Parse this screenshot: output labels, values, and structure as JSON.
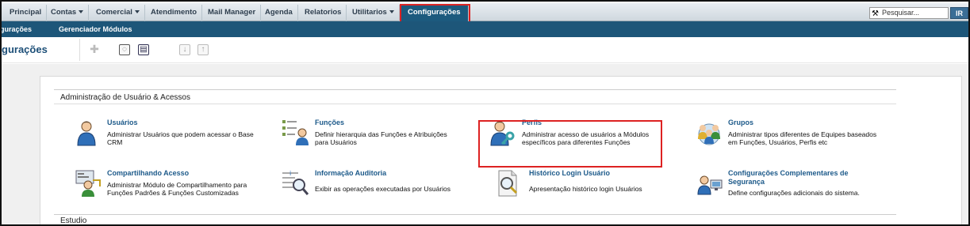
{
  "topnav": {
    "tabs": [
      {
        "label": "Principal",
        "caret": false
      },
      {
        "label": "Contas",
        "caret": true
      },
      {
        "label": "Comercial",
        "caret": true
      },
      {
        "label": "Atendimento",
        "caret": false
      },
      {
        "label": "Mail Manager",
        "caret": false
      },
      {
        "label": "Agenda",
        "caret": false
      },
      {
        "label": "Relatorios",
        "caret": false
      },
      {
        "label": "Utilitarios",
        "caret": true
      },
      {
        "label": "Configurações",
        "caret": false,
        "active": true
      }
    ],
    "search_placeholder": "Pesquisar...",
    "search_button": "IR"
  },
  "subnav": {
    "items": [
      "gurações",
      "Gerenciador Módulos"
    ]
  },
  "toolbar": {
    "title": "gurações",
    "icons": [
      "add-icon",
      "comment-icon",
      "clipboard-icon",
      "download-icon",
      "upload-icon"
    ]
  },
  "section": {
    "title": "Administração de Usuário & Acessos",
    "next_title": "Estudio",
    "items": [
      {
        "title": "Usuários",
        "desc": "Administrar Usuários que podem acessar o Base CRM",
        "icon": "user-icon"
      },
      {
        "title": "Funções",
        "desc": "Definir hierarquia das Funções e Atribuições para Usuários",
        "icon": "roles-icon"
      },
      {
        "title": "Perfis",
        "desc": "Administrar acesso de usuários a Módulos específicos para diferentes Funções",
        "icon": "profile-key-icon"
      },
      {
        "title": "Grupos",
        "desc": "Administrar tipos diferentes de Equipes baseados em Funções, Usuários, Perfis etc",
        "icon": "groups-icon"
      },
      {
        "title": "Compartilhando Acesso",
        "desc": "Administrar Módulo de Compartilhamento para Funções Padrões & Funções Customizadas",
        "icon": "sharing-icon"
      },
      {
        "title": "Informação Auditoria",
        "desc": "Exibir as operações executadas por Usuários",
        "icon": "audit-icon"
      },
      {
        "title": "Histórico Login Usuário",
        "desc": "Apresentação histórico login Usuários",
        "icon": "login-history-icon"
      },
      {
        "title": "Configurações Complementares de Segurança",
        "desc": "Define configurações adicionais do sistema.",
        "icon": "security-settings-icon"
      }
    ]
  },
  "colors": {
    "nav_bg": "#1d5679",
    "active_tab": "#1c5a7e",
    "link": "#1d5a8a",
    "highlight": "#dd2222"
  }
}
